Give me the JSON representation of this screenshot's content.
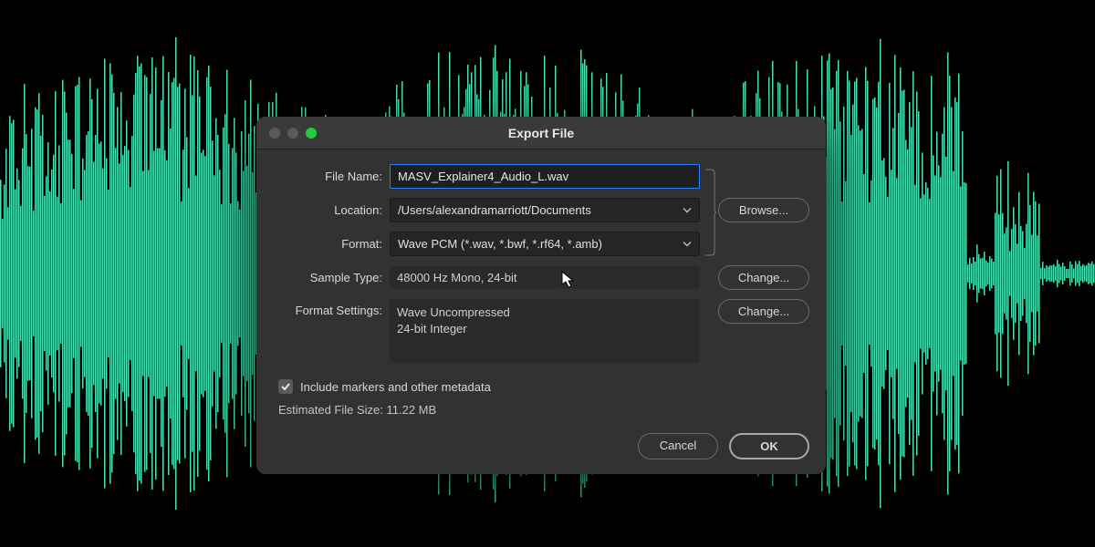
{
  "dialog": {
    "title": "Export File",
    "labels": {
      "file_name": "File Name:",
      "location": "Location:",
      "format": "Format:",
      "sample_type": "Sample Type:",
      "format_settings": "Format Settings:"
    },
    "file_name_value": "MASV_Explainer4_Audio_L.wav",
    "location_value": "/Users/alexandramarriott/Documents",
    "format_value": "Wave PCM (*.wav, *.bwf, *.rf64, *.amb)",
    "sample_type_value": "48000 Hz Mono, 24-bit",
    "format_settings_line1": "Wave Uncompressed",
    "format_settings_line2": "24-bit Integer",
    "buttons": {
      "browse": "Browse...",
      "change_sample": "Change...",
      "change_format": "Change...",
      "cancel": "Cancel",
      "ok": "OK"
    },
    "include_metadata_label": "Include markers and other metadata",
    "include_metadata_checked": true,
    "estimated_prefix": "Estimated File Size: ",
    "estimated_size": "11.22 MB"
  },
  "colors": {
    "waveform": "#4de0b4",
    "dialog_bg": "#323232",
    "accent_blue": "#2a7fff"
  }
}
